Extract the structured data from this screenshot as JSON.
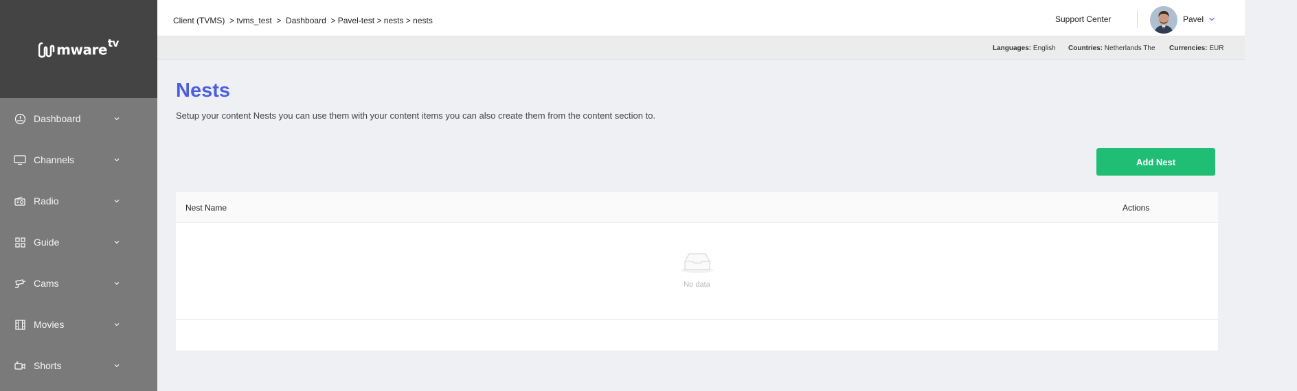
{
  "brand": {
    "name": "mware",
    "suffix": "tv"
  },
  "sidebar": {
    "items": [
      {
        "label": "Dashboard",
        "icon": "dashboard-icon"
      },
      {
        "label": "Channels",
        "icon": "monitor-icon"
      },
      {
        "label": "Radio",
        "icon": "radio-icon"
      },
      {
        "label": "Guide",
        "icon": "guide-icon"
      },
      {
        "label": "Cams",
        "icon": "camera-icon"
      },
      {
        "label": "Movies",
        "icon": "film-icon"
      },
      {
        "label": "Shorts",
        "icon": "video-icon"
      }
    ]
  },
  "header": {
    "breadcrumb": "Client (TVMS)  > tvms_test  >  Dashboard  > Pavel-test > nests > nests",
    "support_label": "Support Center",
    "user_name": "Pavel"
  },
  "info": {
    "languages_label": "Languages:",
    "languages_value": "English",
    "countries_label": "Countries:",
    "countries_value": "Netherlands The",
    "currencies_label": "Currencies:",
    "currencies_value": "EUR"
  },
  "page": {
    "title": "Nests",
    "description": "Setup your content Nests you can use them with your content items you can also create them from the content section to.",
    "add_button": "Add Nest"
  },
  "table": {
    "columns": [
      "Nest Name",
      "Actions"
    ],
    "empty_text": "No data"
  },
  "colors": {
    "title": "#4a5fe0",
    "add_button": "#1fbe74",
    "sidebar": "#7a7a7a",
    "sidebar_header": "#444444"
  }
}
